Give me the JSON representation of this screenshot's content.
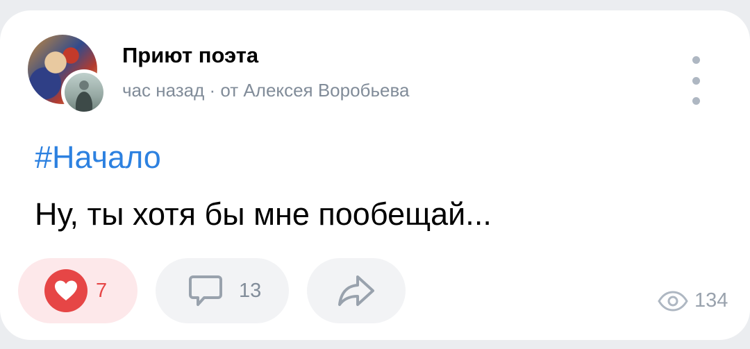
{
  "post": {
    "group_name": "Приют поэта",
    "meta": "час назад · от Алексея Воробьева",
    "hashtag": "#Начало",
    "text": "Ну, ты хотя бы мне пообещай..."
  },
  "actions": {
    "likes": "7",
    "comments": "13",
    "views": "134"
  },
  "icons": {
    "like": "heart-icon",
    "comment": "comment-bubble-icon",
    "share": "share-arrow-icon",
    "views": "eye-icon",
    "more": "more-vertical-icon"
  },
  "colors": {
    "accent": "#2d81e0",
    "like": "#e64646",
    "like_bg": "#fde8ea",
    "secondary_text": "#818c99",
    "button_bg": "#f2f3f5",
    "page_bg": "#ebedf0"
  }
}
